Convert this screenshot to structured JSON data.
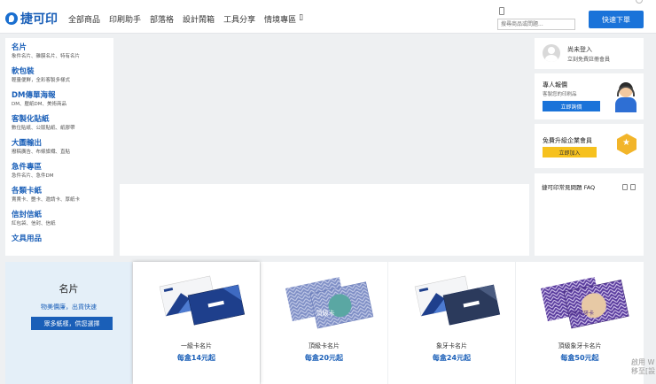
{
  "header": {
    "logo_text": "捷可印",
    "nav": [
      "全部商品",
      "印刷助手",
      "部落格",
      "設計鬧箱",
      "工具分享",
      "情境專區"
    ],
    "search_placeholder": "搜尋商品或問題...",
    "order_button": "快速下單"
  },
  "sidebar": {
    "categories": [
      {
        "title": "名片",
        "sub": "象件名片、雜膜名片、特有名片"
      },
      {
        "title": "軟包裝",
        "sub": "輕量便鮮，全彩客製多樣式"
      },
      {
        "title": "DM傳單海報",
        "sub": "DM、壓紙DM、美術商品"
      },
      {
        "title": "客製化貼紙",
        "sub": "數位貼紙、公版貼紙、紙膠帶"
      },
      {
        "title": "大圖輸出",
        "sub": "撥稿廣告、布條旗幟、直貼"
      },
      {
        "title": "急件專區",
        "sub": "急件名片、急件DM"
      },
      {
        "title": "各類卡紙",
        "sub": "賣賣卡、艷卡、邀請卡、厚紙卡"
      },
      {
        "title": "信封信紙",
        "sub": "紅包袋、信封、信紙"
      },
      {
        "title": "文具用品",
        "sub": ""
      }
    ]
  },
  "right": {
    "login_title": "尚未登入",
    "login_sub": "立刻免費註冊會員",
    "quote_title": "專人報價",
    "quote_sub": "客製您的印刷品",
    "quote_button": "立即詢價",
    "upgrade_title": "免費升級企業會員",
    "upgrade_button": "立即加入",
    "faq_title": "捷可印常見問題 FAQ"
  },
  "promo": {
    "title": "名片",
    "subtitle": "物美價廉，出貨快速",
    "button": "眾多紙樣，供您選擇"
  },
  "products": [
    {
      "name": "一級卡名片",
      "price": "每盒14元起",
      "label": "",
      "color": "#1e3f8c"
    },
    {
      "name": "頂級卡名片",
      "price": "每盒20元起",
      "label": "頂級卡",
      "color": "#5f73b3"
    },
    {
      "name": "象牙卡名片",
      "price": "每盒24元起",
      "label": "",
      "color": "#1e3f8c"
    },
    {
      "name": "頂級象牙卡名片",
      "price": "每盒50元起",
      "label": "頂級象牙卡",
      "color": "#5a3c9e"
    }
  ],
  "watermark": [
    "啟用 W",
    "移至[設"
  ]
}
